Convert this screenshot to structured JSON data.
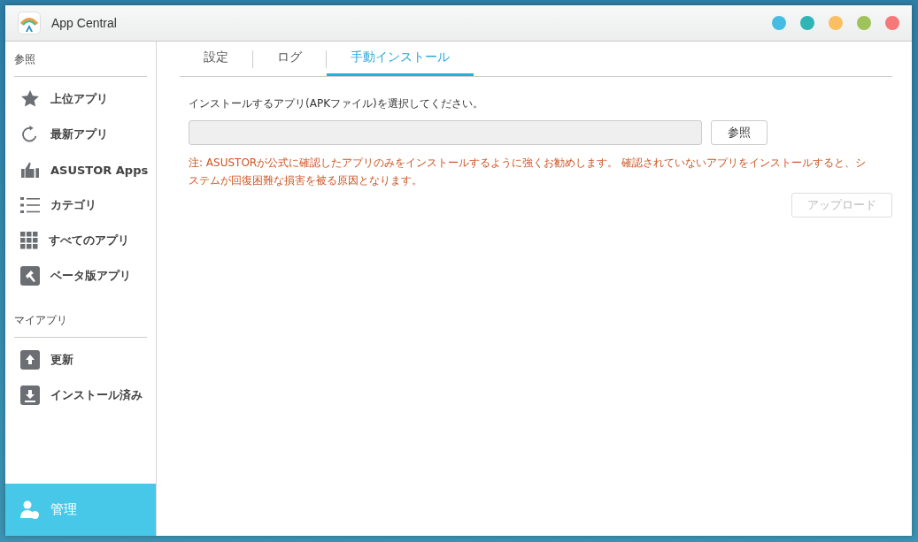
{
  "window": {
    "title": "App Central"
  },
  "window_controls": [
    {
      "color": "#45bde3"
    },
    {
      "color": "#2fb5b5"
    },
    {
      "color": "#fbbf62"
    },
    {
      "color": "#9dc35a"
    },
    {
      "color": "#f67878"
    }
  ],
  "sidebar": {
    "sections": [
      {
        "heading": "参照",
        "items": [
          {
            "label": "上位アプリ",
            "selected": false
          },
          {
            "label": "最新アプリ",
            "selected": false
          },
          {
            "label": "ASUSTOR Apps",
            "selected": false
          },
          {
            "label": "カテゴリ",
            "selected": false
          },
          {
            "label": "すべてのアプリ",
            "selected": false
          },
          {
            "label": "ベータ版アプリ",
            "selected": false
          }
        ]
      },
      {
        "heading": "マイアプリ",
        "items": [
          {
            "label": "更新",
            "selected": false
          },
          {
            "label": "インストール済み",
            "selected": false
          }
        ]
      }
    ],
    "footer_item": {
      "label": "管理",
      "selected": true
    }
  },
  "tabs": [
    {
      "label": "設定",
      "selected": false
    },
    {
      "label": "ログ",
      "selected": false
    },
    {
      "label": "手動インストール",
      "selected": true
    }
  ],
  "install": {
    "prompt": "インストールするアプリ(APKファイル)を選択してください。",
    "browse_button": "参照",
    "warning": "注: ASUSTORが公式に確認したアプリのみをインストールするように強くお勧めします。 確認されていないアプリをインストールすると、システムが回復困難な損害を被る原因となります。",
    "upload_button": {
      "label": "アップロード",
      "disabled": true
    }
  }
}
